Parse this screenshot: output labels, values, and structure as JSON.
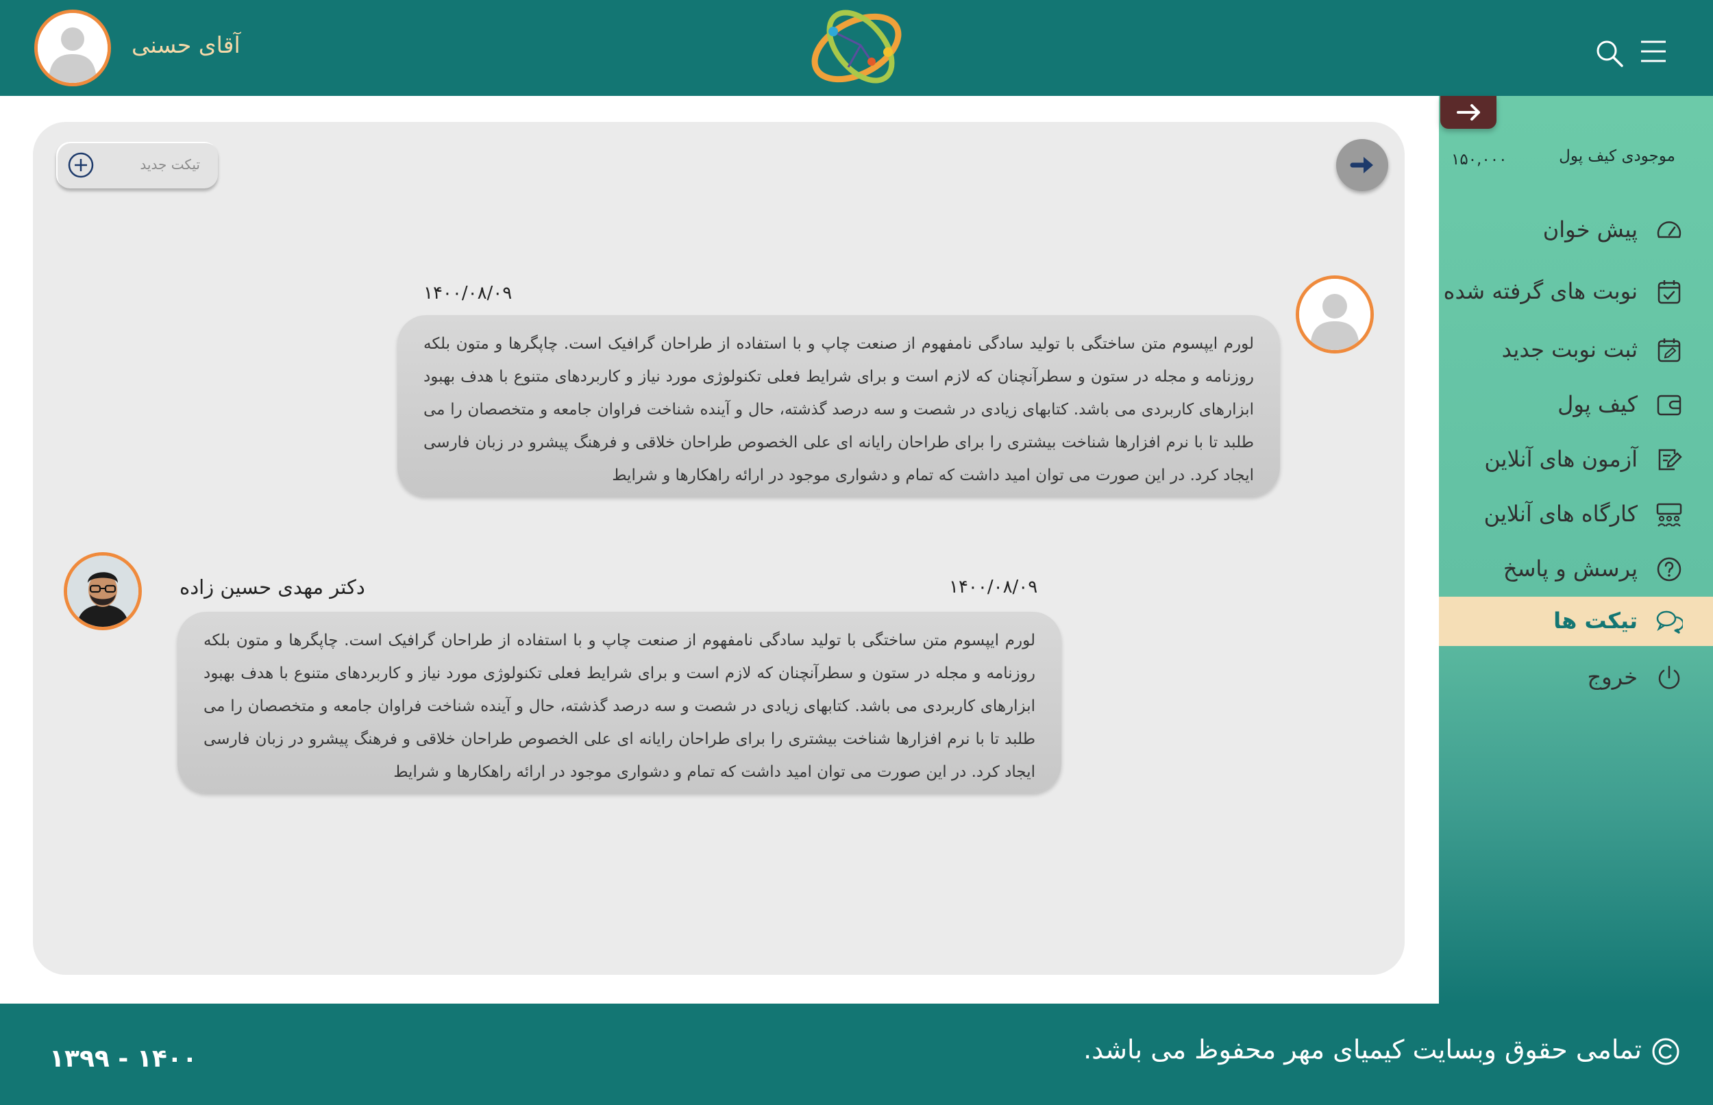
{
  "header": {
    "user_name": "آقای حسنی",
    "logo_icon": "atom-logo-icon",
    "search_icon": "search-icon",
    "menu_icon": "hamburger-menu-icon"
  },
  "sidebar": {
    "collapse_icon": "arrow-right-icon",
    "wallet_label": "موجودی کیف پول",
    "wallet_amount": "۱۵۰,۰۰۰",
    "items": [
      {
        "label": "پیش خوان",
        "icon": "dashboard-gauge-icon",
        "active": false
      },
      {
        "label": "نوبت های گرفته شده",
        "icon": "calendar-check-icon",
        "active": false
      },
      {
        "label": "ثبت نوبت جدید",
        "icon": "calendar-edit-icon",
        "active": false
      },
      {
        "label": "کیف پول",
        "icon": "wallet-icon",
        "active": false
      },
      {
        "label": "آزمون های آنلاین",
        "icon": "exam-edit-icon",
        "active": false
      },
      {
        "label": "کارگاه های آنلاین",
        "icon": "workshop-group-icon",
        "active": false
      },
      {
        "label": "پرسش و پاسخ",
        "icon": "question-circle-icon",
        "active": false
      },
      {
        "label": "تیکت ها",
        "icon": "chat-bubbles-icon",
        "active": true
      },
      {
        "label": "خروج",
        "icon": "power-icon",
        "active": false
      }
    ]
  },
  "toolbar": {
    "new_ticket_label": "تیکت جدید",
    "new_ticket_icon": "plus-circle-icon",
    "back_icon": "arrow-right-icon"
  },
  "messages": [
    {
      "sender": "user",
      "author": "",
      "date": "۱۴۰۰/۰۸/۰۹",
      "text": "لورم ایپسوم متن ساختگی با تولید سادگی نامفهوم از صنعت چاپ و با استفاده از طراحان گرافیک است. چاپگرها و متون بلکه روزنامه و مجله در ستون و سطرآنچنان که لازم است و برای شرایط فعلی تکنولوژی مورد نیاز و کاربردهای متنوع با هدف بهبود ابزارهای کاربردی می باشد. کتابهای زیادی در شصت و سه درصد گذشته، حال و آینده شناخت فراوان جامعه و متخصصان را می طلبد تا با نرم افزارها شناخت بیشتری را برای طراحان رایانه ای علی الخصوص طراحان خلاقی و فرهنگ پیشرو در زبان فارسی ایجاد کرد. در این صورت می توان امید داشت که تمام و دشواری موجود در ارائه راهکارها و شرایط"
    },
    {
      "sender": "doctor",
      "author": "دکتر مهدی حسین زاده",
      "date": "۱۴۰۰/۰۸/۰۹",
      "text": "لورم ایپسوم متن ساختگی با تولید سادگی نامفهوم از صنعت چاپ و با استفاده از طراحان گرافیک است. چاپگرها و متون بلکه روزنامه و مجله در ستون و سطرآنچنان که لازم است و برای شرایط فعلی تکنولوژی مورد نیاز و کاربردهای متنوع با هدف بهبود ابزارهای کاربردی می باشد. کتابهای زیادی در شصت و سه درصد گذشته، حال و آینده شناخت فراوان جامعه و متخصصان را می طلبد تا با نرم افزارها شناخت بیشتری را برای طراحان رایانه ای علی الخصوص طراحان خلاقی و فرهنگ پیشرو در زبان فارسی ایجاد کرد. در این صورت می توان امید داشت که تمام و دشواری موجود در ارائه راهکارها و شرایط"
    }
  ],
  "footer": {
    "copyright_icon": "copyright-icon",
    "copyright_text": "تمامی حقوق وبسایت کیمیای مهر محفوظ می باشد.",
    "years": "۱۳۹۹ - ۱۴۰۰"
  },
  "colors": {
    "header_bg": "#137673",
    "accent_orange": "#ef8a3c",
    "active_item_bg": "#f5deb6",
    "sidebar_bg": "#6ccaa9",
    "panel_bg": "#ebebeb",
    "bubble_bg": "#cfcfcf"
  }
}
